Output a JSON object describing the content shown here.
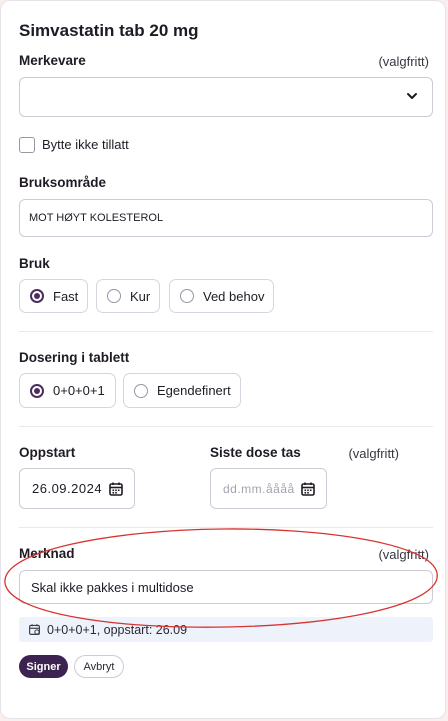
{
  "form": {
    "title": "Simvastatin tab 20 mg",
    "brand": {
      "label": "Merkevare",
      "optional": "(valgfritt)",
      "value": ""
    },
    "substitution": {
      "label": "Bytte ikke tillatt",
      "checked": false
    },
    "usage_area": {
      "label": "Bruksområde",
      "value": "MOT HØYT KOLESTEROL"
    },
    "usage": {
      "label": "Bruk",
      "options": [
        "Fast",
        "Kur",
        "Ved behov"
      ],
      "selected": "Fast"
    },
    "dosing": {
      "label": "Dosering i tablett",
      "options": [
        "0+0+0+1",
        "Egendefinert"
      ],
      "selected": "0+0+0+1"
    },
    "start": {
      "label": "Oppstart",
      "value": "26.09.2024"
    },
    "last_dose": {
      "label": "Siste dose tas",
      "optional": "(valgfritt)",
      "placeholder": "dd.mm.åååå"
    },
    "note": {
      "label": "Merknad",
      "optional": "(valgfritt)",
      "value": "Skal ikke pakkes i multidose"
    },
    "summary": "0+0+0+1, oppstart: 26.09",
    "buttons": {
      "sign": "Signer",
      "cancel": "Avbryt"
    }
  },
  "annotation": {
    "type": "ellipse",
    "color": "#d8342f"
  },
  "colors": {
    "accent": "#4b2d5f",
    "primary_button": "#3d2350",
    "info_bg": "#eef3fb"
  },
  "icons": [
    "chevron-down-icon",
    "calendar-icon",
    "calendar-icon",
    "calendar-summary-icon"
  ]
}
